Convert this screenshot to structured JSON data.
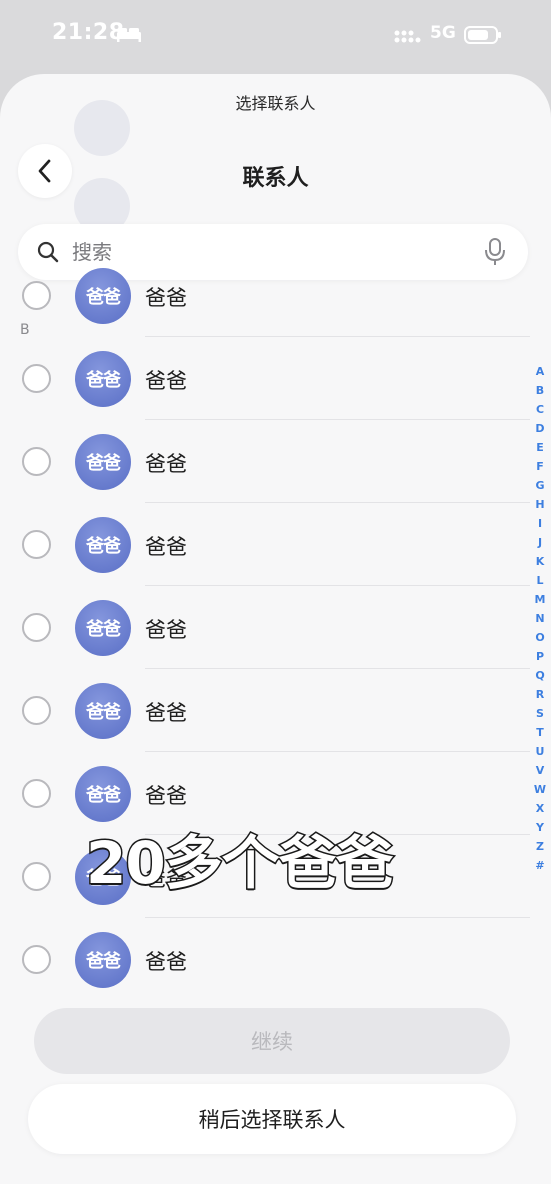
{
  "status_bar": {
    "time": "21:28",
    "network": "5G"
  },
  "sheet": {
    "title": "选择联系人"
  },
  "header": {
    "title": "联系人",
    "back_icon": "chevron-left-icon"
  },
  "search": {
    "placeholder": "搜索",
    "value": ""
  },
  "section": {
    "letter": "B"
  },
  "contacts": [
    {
      "name": "爸爸",
      "avatar_text": "爸爸"
    },
    {
      "name": "爸爸",
      "avatar_text": "爸爸"
    },
    {
      "name": "爸爸",
      "avatar_text": "爸爸"
    },
    {
      "name": "爸爸",
      "avatar_text": "爸爸"
    },
    {
      "name": "爸爸",
      "avatar_text": "爸爸"
    },
    {
      "name": "爸爸",
      "avatar_text": "爸爸"
    },
    {
      "name": "爸爸",
      "avatar_text": "爸爸"
    },
    {
      "name": "爸爸",
      "avatar_text": "爸爸"
    },
    {
      "name": "爸爸",
      "avatar_text": "爸爸"
    }
  ],
  "alpha_index": [
    "A",
    "B",
    "C",
    "D",
    "E",
    "F",
    "G",
    "H",
    "I",
    "J",
    "K",
    "L",
    "M",
    "N",
    "O",
    "P",
    "Q",
    "R",
    "S",
    "T",
    "U",
    "V",
    "W",
    "X",
    "Y",
    "Z",
    "#"
  ],
  "caption": "20多个爸爸",
  "buttons": {
    "continue": "继续",
    "later": "稍后选择联系人"
  },
  "colors": {
    "accent": "#3d7fe0",
    "avatar": "#6b7fd1"
  }
}
